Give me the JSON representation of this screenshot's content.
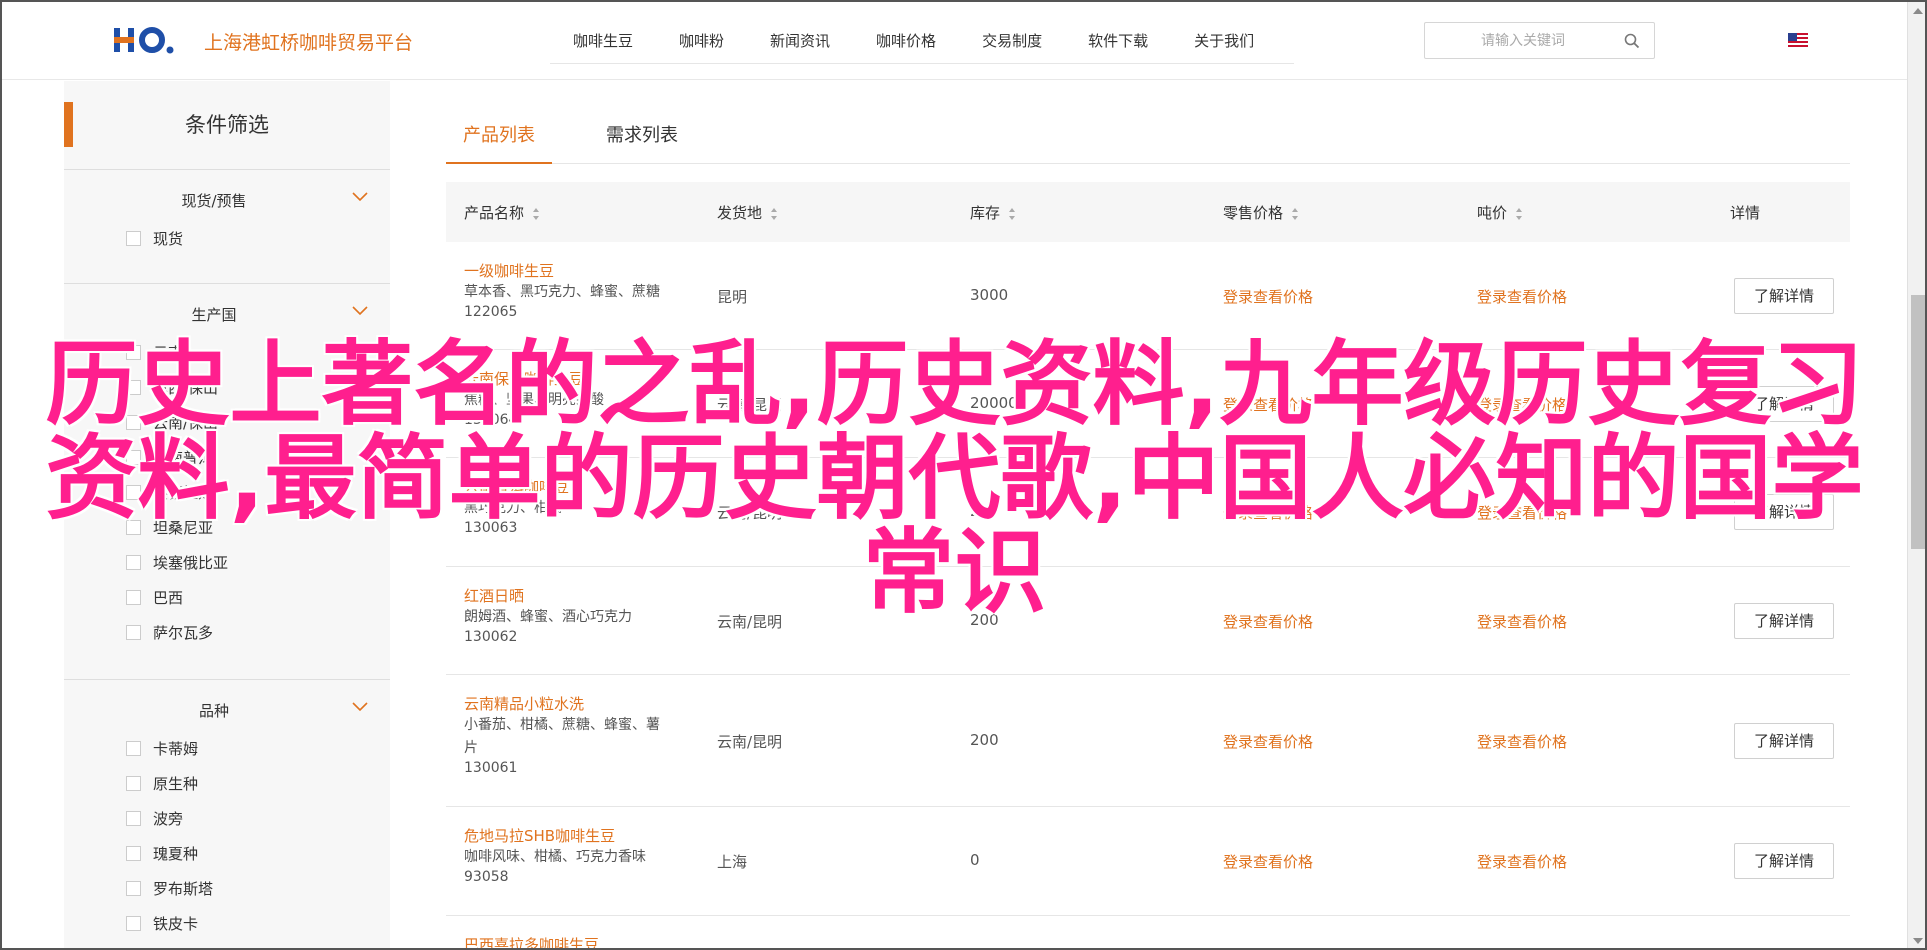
{
  "header": {
    "logo_text": "上海港虹桥咖啡贸易平台",
    "nav": [
      "咖啡生豆",
      "咖啡粉",
      "新闻资讯",
      "咖啡价格",
      "交易制度",
      "软件下载",
      "关于我们"
    ],
    "search_placeholder": "请输入关键词"
  },
  "sidebar": {
    "title": "条件筛选",
    "sections": [
      {
        "label": "现货/预售",
        "options": [
          "现货"
        ]
      },
      {
        "label": "生产国",
        "options": [
          "云南",
          "巴西/保山",
          "云南/保山",
          "云南普洱",
          "洪都拉斯",
          "坦桑尼亚",
          "埃塞俄比亚",
          "巴西",
          "萨尔瓦多"
        ]
      },
      {
        "label": "品种",
        "options": [
          "卡蒂姆",
          "原生种",
          "波旁",
          "瑰夏种",
          "罗布斯塔",
          "铁皮卡"
        ]
      }
    ]
  },
  "main": {
    "tabs": [
      "产品列表",
      "需求列表"
    ],
    "columns": [
      "产品名称",
      "发货地",
      "库存",
      "零售价格",
      "吨价",
      "详情"
    ],
    "rows": [
      {
        "name": "一级咖啡生豆",
        "desc": "草本香、黑巧克力、蜂蜜、蔗糖",
        "id": "122065",
        "origin": "昆明",
        "stock": "3000",
        "retail": "登录查看价格",
        "ton": "登录查看价格",
        "detail": "了解详情"
      },
      {
        "name": "云南保山咖啡生豆",
        "desc": "焦糖、坚果、明亮果酸",
        "id": "130064",
        "origin": "云南/昆明",
        "stock": "20000",
        "retail": "登录查看价格",
        "ton": "登录查看价格",
        "detail": "了解详情"
      },
      {
        "name": "云南普洱咖啡豆",
        "desc": "黑巧克力、柑橘",
        "id": "130063",
        "origin": "云南/昆明",
        "stock": "200",
        "retail": "登录查看价格",
        "ton": "登录查看价格",
        "detail": "了解详情"
      },
      {
        "name": "红酒日晒",
        "desc": "朗姆酒、蜂蜜、酒心巧克力",
        "id": "130062",
        "origin": "云南/昆明",
        "stock": "200",
        "retail": "登录查看价格",
        "ton": "登录查看价格",
        "detail": "了解详情"
      },
      {
        "name": "云南精品小粒水洗",
        "desc": "小番茄、柑橘、蔗糖、蜂蜜、薯",
        "desc2": "片",
        "id": "130061",
        "origin": "云南/昆明",
        "stock": "200",
        "retail": "登录查看价格",
        "ton": "登录查看价格",
        "detail": "了解详情"
      },
      {
        "name": "危地马拉SHB咖啡生豆",
        "desc": "咖啡风味、柑橘、巧克力香味",
        "id": "93058",
        "origin": "上海",
        "stock": "0",
        "retail": "登录查看价格",
        "ton": "登录查看价格",
        "detail": "了解详情"
      },
      {
        "name": "巴西喜拉多咖啡生豆",
        "desc": "",
        "id": "",
        "origin": "",
        "stock": "",
        "retail": "",
        "ton": "",
        "detail": ""
      }
    ]
  },
  "overlay": {
    "line1": "历史上著名的之乱,历史资料,九年级历史复习",
    "line2": "资料,最简单的历史朝代歌,中国人必知的国学",
    "line3": "常识"
  },
  "colors": {
    "accent": "#e0731f",
    "overlay": "#ff1f8e"
  },
  "icons": [
    "search-icon",
    "us-flag-icon",
    "chevron-down-icon",
    "sort-icon"
  ]
}
